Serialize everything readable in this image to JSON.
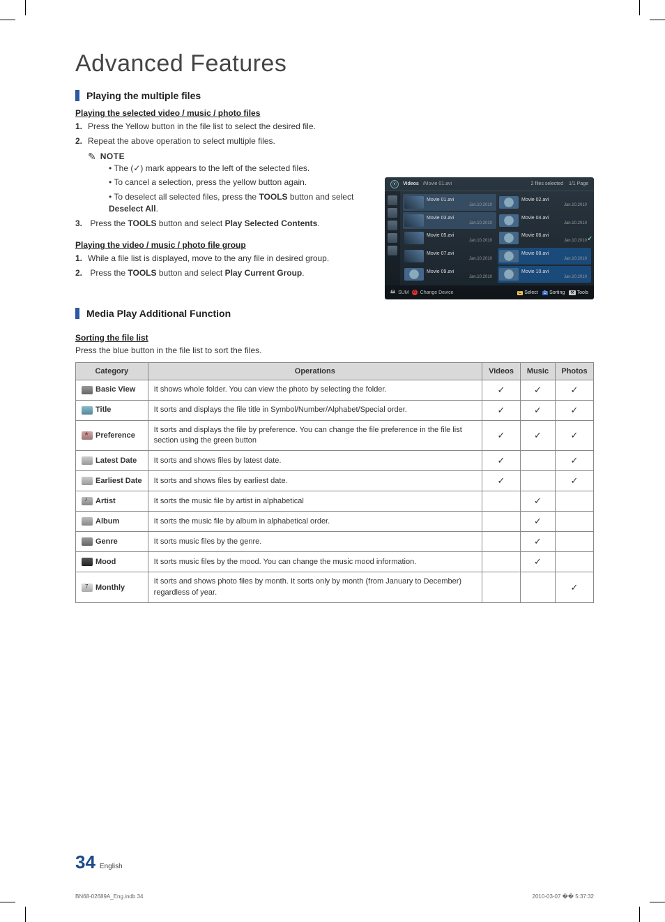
{
  "mainTitle": "Advanced Features",
  "sec1": {
    "heading": "Playing the multiple files",
    "sub1": "Playing the selected video / music / photo files",
    "step1": "Press the Yellow button in the file list to select the desired file.",
    "step2": "Repeat the above operation to select multiple files.",
    "noteLabel": "NOTE",
    "bullet1_a": "The (",
    "bullet1_b": ") mark appears to the left of the selected files.",
    "bullet2": "To cancel a selection, press the yellow button again.",
    "bullet3_a": "To deselect all selected files, press the ",
    "bullet3_tools": "TOOLS",
    "bullet3_b": " button and select ",
    "bullet3_deselect": "Deselect All",
    "bullet3_c": ".",
    "step3_a": "Press the ",
    "step3_tools": "TOOLS",
    "step3_b": " button and select ",
    "step3_play": "Play Selected Contents",
    "step3_c": ".",
    "sub2": "Playing the video / music / photo file group",
    "g_step1": "While a file list is displayed, move to the any file in desired group.",
    "g_step2_a": "Press the ",
    "g_step2_tools": "TOOLS",
    "g_step2_b": " button and select ",
    "g_step2_play": "Play Current Group",
    "g_step2_c": "."
  },
  "tv": {
    "videosLabel": "Videos",
    "path": "/Movie 01.avi",
    "selected": "2 files selected",
    "page": "1/1 Page",
    "files": [
      {
        "name": "Movie 01.avi",
        "date": "Jan.10.2010",
        "selected": true,
        "thumb": true
      },
      {
        "name": "Movie 02.avi",
        "date": "Jan.10.2010",
        "selected": false,
        "thumb": false
      },
      {
        "name": "Movie 03.avi",
        "date": "Jan.10.2010",
        "selected": true,
        "thumb": true
      },
      {
        "name": "Movie 04.avi",
        "date": "Jan.10.2010",
        "selected": false,
        "thumb": false
      },
      {
        "name": "Movie 05.avi",
        "date": "Jan.10.2010",
        "selected": false,
        "thumb": true
      },
      {
        "name": "Movie 06.avi",
        "date": "Jan.10.2010",
        "selected": false,
        "thumb": false
      },
      {
        "name": "Movie 07.avi",
        "date": "Jan.10.2010",
        "selected": false,
        "thumb": true
      },
      {
        "name": "Movie 08.avi",
        "date": "Jan.10.2010",
        "highlight": true,
        "thumb": false
      },
      {
        "name": "Movie 09.avi",
        "date": "Jan.10.2010",
        "selected": false,
        "thumb": false
      },
      {
        "name": "Movie 10.avi",
        "date": "Jan.10.2010",
        "highlight": true,
        "thumb": false
      }
    ],
    "sum": "SUM",
    "changeDevice": "Change Device",
    "select": "Select",
    "sorting": "Sorting",
    "tools": "Tools"
  },
  "sec2": {
    "heading": "Media Play Additional Function",
    "sub": "Sorting the file list",
    "intro": "Press the blue button in the file list to sort the files."
  },
  "table": {
    "hCategory": "Category",
    "hOperations": "Operations",
    "hVideos": "Videos",
    "hMusic": "Music",
    "hPhotos": "Photos",
    "rows": [
      {
        "icon": "ico-folder",
        "cat": "Basic View",
        "op": "It shows whole folder. You can view the photo by selecting the folder.",
        "v": "✓",
        "m": "✓",
        "p": "✓"
      },
      {
        "icon": "ico-title",
        "cat": "Title",
        "op": "It sorts and displays the file title in Symbol/Number/Alphabet/Special order.",
        "v": "✓",
        "m": "✓",
        "p": "✓"
      },
      {
        "icon": "ico-pref",
        "cat": "Preference",
        "op": "It sorts and displays the file by preference. You can change the file preference in the file list section using the green button",
        "v": "✓",
        "m": "✓",
        "p": "✓"
      },
      {
        "icon": "ico-ldate",
        "cat": "Latest Date",
        "op": "It sorts and shows files by latest date.",
        "v": "✓",
        "m": "",
        "p": "✓"
      },
      {
        "icon": "ico-edate",
        "cat": "Earliest Date",
        "op": "It sorts and shows files by earliest date.",
        "v": "✓",
        "m": "",
        "p": "✓"
      },
      {
        "icon": "ico-artist",
        "cat": "Artist",
        "op": "It sorts the music file by artist in alphabetical",
        "v": "",
        "m": "✓",
        "p": ""
      },
      {
        "icon": "ico-album",
        "cat": "Album",
        "op": "It sorts the music file by album in alphabetical order.",
        "v": "",
        "m": "✓",
        "p": ""
      },
      {
        "icon": "ico-genre",
        "cat": "Genre",
        "op": "It sorts music files by the genre.",
        "v": "",
        "m": "✓",
        "p": ""
      },
      {
        "icon": "ico-mood",
        "cat": "Mood",
        "op": "It sorts music files by the mood. You can change the music mood information.",
        "v": "",
        "m": "✓",
        "p": ""
      },
      {
        "icon": "ico-month",
        "cat": "Monthly",
        "op": "It sorts and shows photo files by month. It sorts only by month (from January to December) regardless of year.",
        "v": "",
        "m": "",
        "p": "✓"
      }
    ]
  },
  "footer": {
    "pageNum": "34",
    "lang": "English",
    "docRef": "BN68-02689A_Eng.indb   34",
    "timestamp": "2010-03-07   �� 5:37:32"
  }
}
